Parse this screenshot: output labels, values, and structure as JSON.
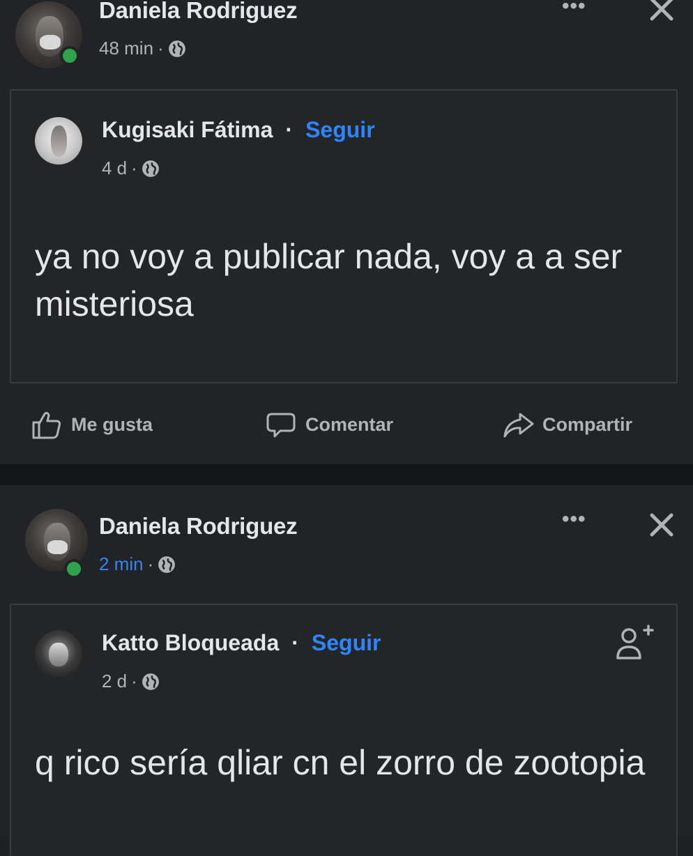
{
  "posts": [
    {
      "author": "Daniela Rodriguez",
      "time": "48 min",
      "separator": "·",
      "shared": {
        "author": "Kugisaki Fátima",
        "bullet": "·",
        "follow": "Seguir",
        "time": "4 d",
        "separator": "·",
        "text": "ya no voy a publicar nada, voy a a ser misteriosa"
      },
      "actions": {
        "like": "Me gusta",
        "comment": "Comentar",
        "share": "Compartir"
      }
    },
    {
      "author": "Daniela Rodriguez",
      "time": "2 min",
      "separator": "·",
      "shared": {
        "author": "Katto Bloqueada",
        "bullet": "·",
        "follow": "Seguir",
        "time": "2 d",
        "separator": "·",
        "text": "q rico sería qliar cn el zorro de zootopia"
      }
    }
  ],
  "icons": {
    "more": "more-options-icon",
    "close": "close-icon",
    "globe": "globe-icon",
    "like": "thumbs-up-icon",
    "comment": "comment-icon",
    "share": "share-arrow-icon",
    "add_friend": "add-friend-icon"
  },
  "colors": {
    "background": "#222326",
    "link": "#2d86ff",
    "online": "#31a24c"
  }
}
